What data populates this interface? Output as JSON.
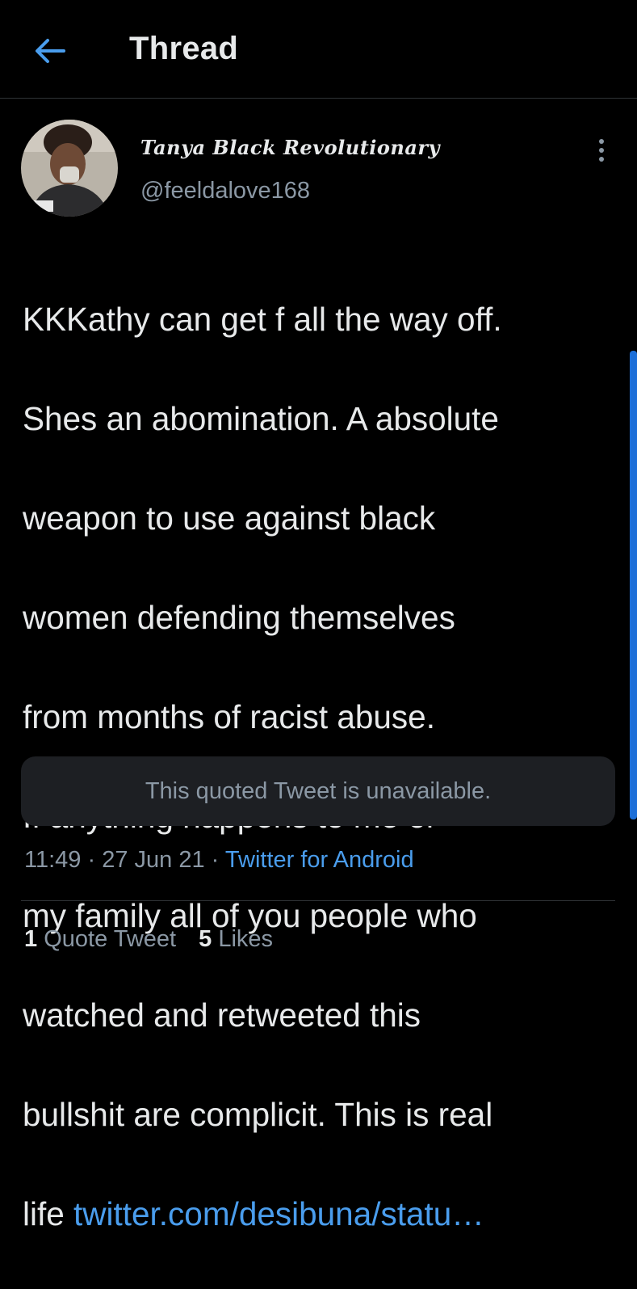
{
  "header": {
    "title": "Thread",
    "back_icon": "arrow-left-icon"
  },
  "colors": {
    "background": "#000000",
    "text": "#e7e9ea",
    "secondary_text": "#8b98a5",
    "link": "#4a9ded",
    "quote_box": "#1d1f23",
    "divider": "#2f3336"
  },
  "tweet": {
    "display_name": "Tanya Black Revolutionary",
    "handle": "@feeldalove168",
    "more_icon": "more-vertical-icon",
    "text_lines": [
      "KKKathy can get f all the way off.",
      "Shes an abomination. A absolute",
      "weapon to use against black",
      "women defending themselves",
      "from months of racist abuse.",
      "If anything happens to me or",
      "my family all of you people who",
      "watched and retweeted this",
      "bullshit are complicit. This is real"
    ],
    "last_line_prefix": "life ",
    "link_text": "twitter.com/desibuna/statu…",
    "quoted_unavailable": "This quoted Tweet is unavailable.",
    "time": "11:49",
    "date": "27 Jun 21",
    "separator": "·",
    "source": "Twitter for Android",
    "quote_tweets_count": "1",
    "quote_tweets_label": "Quote Tweet",
    "likes_count": "5",
    "likes_label": "Likes"
  }
}
